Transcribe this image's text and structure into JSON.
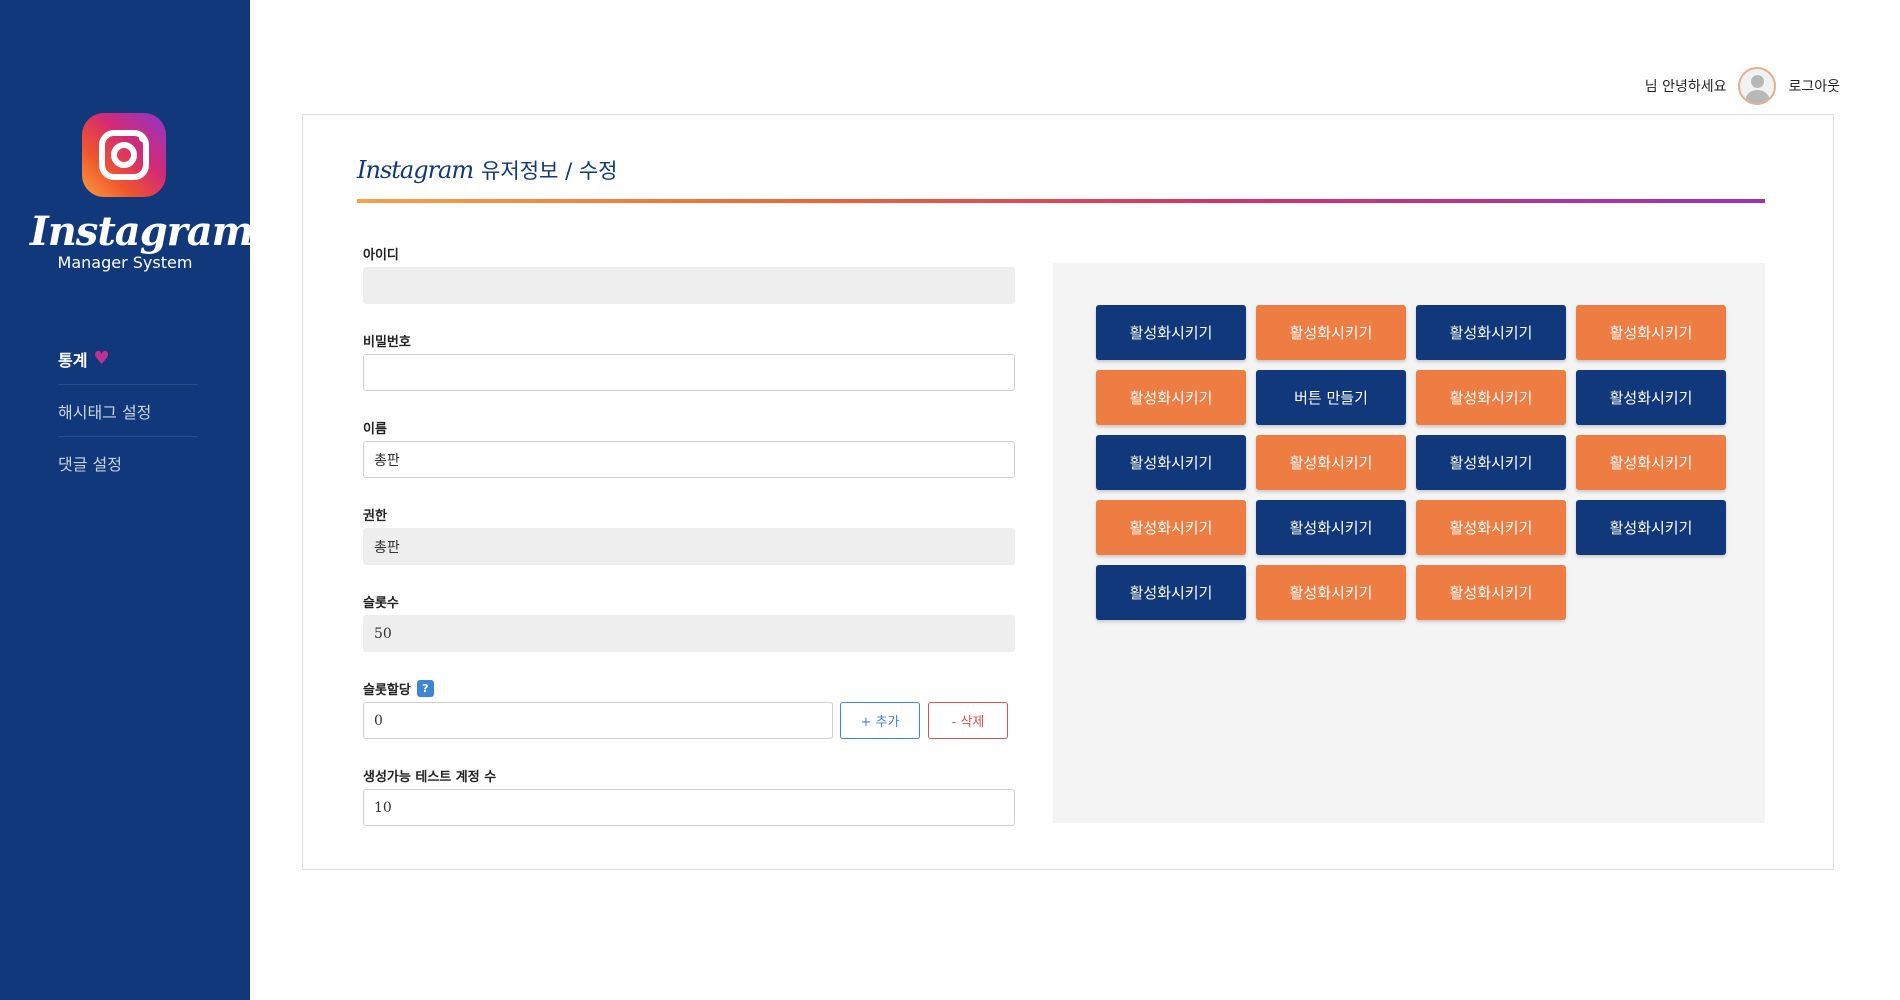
{
  "sidebar": {
    "brand_script": "Instagram",
    "brand_sub": "Manager System",
    "items": [
      {
        "label": "통계",
        "active": true
      },
      {
        "label": "해시태그 설정",
        "active": false
      },
      {
        "label": "댓글 설정",
        "active": false
      }
    ]
  },
  "header": {
    "greeting": "님 안녕하세요",
    "logout": "로그아웃"
  },
  "card": {
    "title_script": "Instagram",
    "title": "유저정보 / 수정"
  },
  "form": {
    "id": {
      "label": "아이디",
      "value": ""
    },
    "password": {
      "label": "비밀번호",
      "value": ""
    },
    "name": {
      "label": "이름",
      "value": "총판"
    },
    "role": {
      "label": "권한",
      "value": "총판"
    },
    "slot_count": {
      "label": "슬롯수",
      "value": "50"
    },
    "slot_assign": {
      "label": "슬롯할당",
      "help": "?",
      "value": "0",
      "add_label": "+ 추가",
      "delete_label": "- 삭제"
    },
    "test_accounts": {
      "label": "생성가능 테스트 계정 수",
      "value": "10"
    }
  },
  "buttons": [
    {
      "label": "활성화시키기",
      "color": "navy"
    },
    {
      "label": "활성화시키기",
      "color": "orange"
    },
    {
      "label": "활성화시키기",
      "color": "navy"
    },
    {
      "label": "활성화시키기",
      "color": "orange"
    },
    {
      "label": "활성화시키기",
      "color": "orange"
    },
    {
      "label": "버튼 만들기",
      "color": "navy"
    },
    {
      "label": "활성화시키기",
      "color": "orange"
    },
    {
      "label": "활성화시키기",
      "color": "navy"
    },
    {
      "label": "활성화시키기",
      "color": "navy"
    },
    {
      "label": "활성화시키기",
      "color": "orange"
    },
    {
      "label": "활성화시키기",
      "color": "navy"
    },
    {
      "label": "활성화시키기",
      "color": "orange"
    },
    {
      "label": "활성화시키기",
      "color": "orange"
    },
    {
      "label": "활성화시키기",
      "color": "navy"
    },
    {
      "label": "활성화시키기",
      "color": "orange"
    },
    {
      "label": "활성화시키기",
      "color": "navy"
    },
    {
      "label": "활성화시키기",
      "color": "navy"
    },
    {
      "label": "활성화시키기",
      "color": "orange"
    },
    {
      "label": "활성화시키기",
      "color": "orange"
    }
  ],
  "colors": {
    "sidebar_bg": "#11387a",
    "navy": "#11387a",
    "orange": "#ee7d43",
    "panel_bg": "#f4f4f4",
    "add_button": "#3d86d6",
    "delete_button": "#d9534f"
  },
  "icons": {
    "logo": "instagram-logo-icon",
    "nav_active": "heart-icon",
    "avatar": "user-avatar-icon",
    "help": "help-icon"
  }
}
